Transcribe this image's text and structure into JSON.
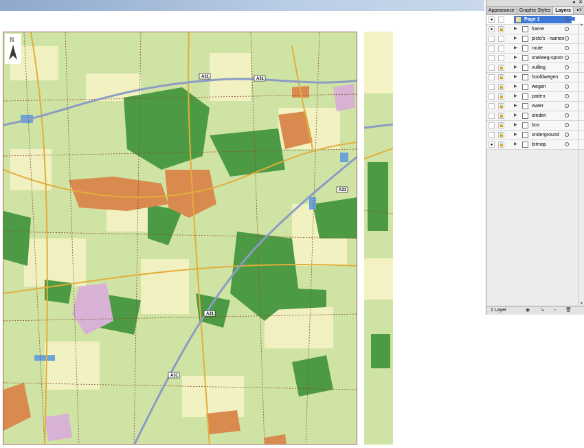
{
  "panel": {
    "tabs": [
      {
        "label": "Appearance",
        "active": false
      },
      {
        "label": "Graphic Styles",
        "active": false
      },
      {
        "label": "Layers",
        "active": true
      }
    ],
    "top_layer": {
      "label": "Page 1",
      "visible": true,
      "locked": false,
      "selected": true
    },
    "sublayers": [
      {
        "label": "frame",
        "visible": true,
        "locked": true
      },
      {
        "label": "picto's - namen",
        "visible": false,
        "locked": false
      },
      {
        "label": "route",
        "visible": false,
        "locked": false
      },
      {
        "label": "snelweg-spoor",
        "visible": false,
        "locked": false
      },
      {
        "label": "vulling",
        "visible": false,
        "locked": true
      },
      {
        "label": "hoofdwegen",
        "visible": false,
        "locked": true
      },
      {
        "label": "wegen",
        "visible": false,
        "locked": true
      },
      {
        "label": "paden",
        "visible": false,
        "locked": true
      },
      {
        "label": "water",
        "visible": false,
        "locked": true
      },
      {
        "label": "steden",
        "visible": false,
        "locked": true
      },
      {
        "label": "bos",
        "visible": false,
        "locked": true
      },
      {
        "label": "onderground",
        "visible": false,
        "locked": true
      },
      {
        "label": "bitmap",
        "visible": true,
        "locked": true
      }
    ],
    "footer": {
      "count": "1 Layer"
    }
  },
  "map": {
    "compass_letter": "N",
    "road_labels": [
      "A31",
      "A31",
      "A31",
      "A31",
      "A31"
    ],
    "colors": {
      "meadow": "#cfe3a4",
      "field": "#f4f2c4",
      "forest": "#4c9b44",
      "town": "#d98a4e",
      "motorway": "#8a9cc4",
      "road": "#e3ad3b",
      "water": "#6ba3d6"
    }
  },
  "icons": {
    "visible": "eye-icon",
    "locked": "lock-icon",
    "expand": "triangle-right-icon",
    "target": "target-circle-icon"
  }
}
